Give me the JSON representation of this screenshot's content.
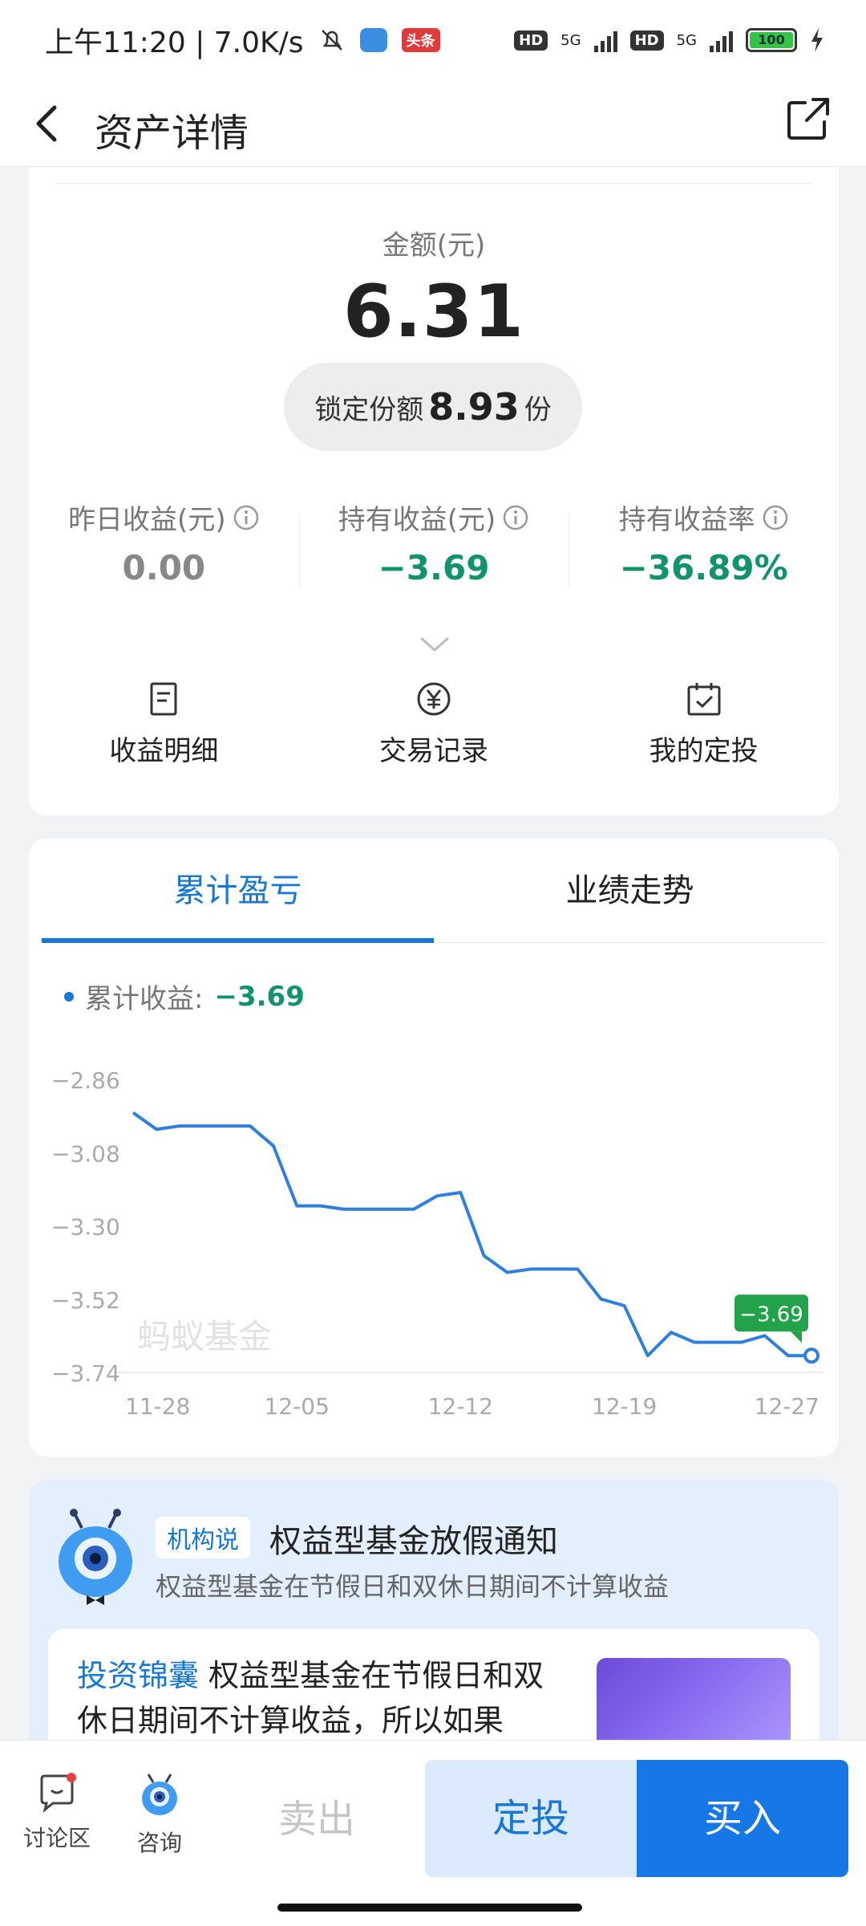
{
  "status_bar": {
    "time_speed": "上午11:20 | 7.0K/s",
    "toutiao_badge": "头条",
    "hd1": "HD",
    "net1": "5G",
    "hd2": "HD",
    "net2": "5G",
    "battery": "100"
  },
  "header": {
    "title": "资产详情"
  },
  "asset": {
    "amount_label": "金额(元)",
    "amount_value": "6.31",
    "locked_prefix": "锁定份额",
    "locked_value": "8.93",
    "locked_suffix": "份",
    "stats": [
      {
        "label": "昨日收益(元)",
        "value": "0.00"
      },
      {
        "label": "持有收益(元)",
        "value": "−3.69"
      },
      {
        "label": "持有收益率",
        "value": "−36.89%"
      }
    ],
    "actions": [
      {
        "label": "收益明细",
        "icon": "document-icon"
      },
      {
        "label": "交易记录",
        "icon": "yen-circle-icon"
      },
      {
        "label": "我的定投",
        "icon": "calendar-check-icon"
      }
    ]
  },
  "chart_section": {
    "tabs": [
      "累计盈亏",
      "业绩走势"
    ],
    "active_tab": 0,
    "legend_label": "累计收益:",
    "legend_value": "−3.69",
    "watermark": "蚂蚁基金",
    "colors": {
      "line": "#2f7fe0",
      "badge": "#22a34a",
      "negative": "#12936c",
      "accent": "#1677d6"
    }
  },
  "chart_data": {
    "type": "line",
    "title": "",
    "xlabel": "",
    "ylabel": "",
    "y_ticks": [
      "−2.86",
      "−3.08",
      "−3.30",
      "−3.52",
      "−3.74"
    ],
    "ylim": [
      -3.74,
      -2.86
    ],
    "x_tick_labels": [
      "11-28",
      "12-05",
      "12-12",
      "12-19",
      "12-27"
    ],
    "x": [
      "11-28",
      "11-29",
      "11-30",
      "12-01",
      "12-02",
      "12-03",
      "12-04",
      "12-05",
      "12-06",
      "12-07",
      "12-08",
      "12-09",
      "12-10",
      "12-11",
      "12-12",
      "12-13",
      "12-14",
      "12-15",
      "12-16",
      "12-17",
      "12-18",
      "12-19",
      "12-20",
      "12-21",
      "12-22",
      "12-23",
      "12-24",
      "12-25",
      "12-26",
      "12-27"
    ],
    "series": [
      {
        "values": [
          -2.96,
          -3.01,
          -3.0,
          -3.0,
          -3.0,
          -3.0,
          -3.06,
          -3.24,
          -3.24,
          -3.25,
          -3.25,
          -3.25,
          -3.25,
          -3.21,
          -3.2,
          -3.39,
          -3.44,
          -3.43,
          -3.43,
          -3.43,
          -3.52,
          -3.54,
          -3.69,
          -3.62,
          -3.65,
          -3.65,
          -3.65,
          -3.63,
          -3.69,
          -3.69
        ]
      }
    ],
    "last_value_label": "−3.69",
    "grid": false,
    "legend": "top-left"
  },
  "notice": {
    "tag": "机构说",
    "title": "权益型基金放假通知",
    "subtitle": "权益型基金在节假日和双休日期间不计算收益",
    "article_keyword": "投资锦囊",
    "article_text": "权益型基金在节假日和双休日期间不计算收益，所以如果在..."
  },
  "bottom_bar": {
    "discuss_label": "讨论区",
    "consult_label": "咨询",
    "sell_label": "卖出",
    "plan_label": "定投",
    "buy_label": "买入"
  }
}
